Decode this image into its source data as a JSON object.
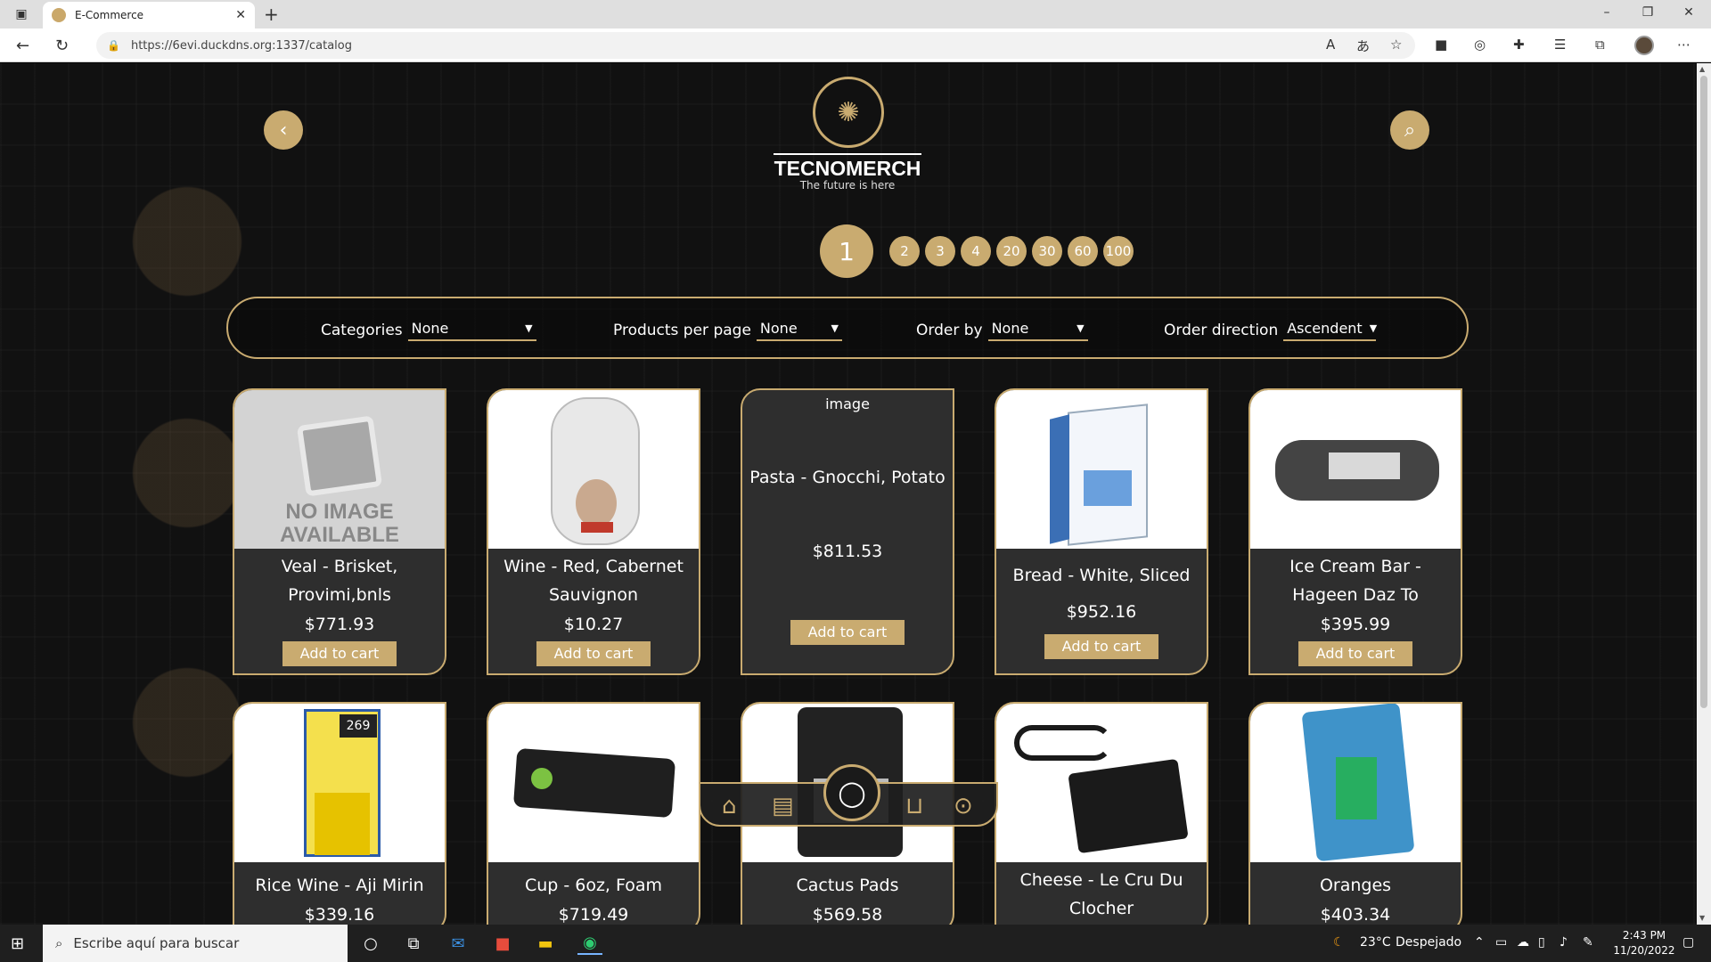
{
  "browser": {
    "tab_title": "E-Commerce",
    "url": "https://6evi.duckdns.org:1337/catalog"
  },
  "site": {
    "brand": "TECNOMERCH",
    "tagline": "The future is here"
  },
  "pagination": {
    "current": "1",
    "pages": [
      "2",
      "3",
      "4",
      "20",
      "30",
      "60",
      "100"
    ]
  },
  "filters": {
    "categories_label": "Categories",
    "categories_value": "None",
    "per_page_label": "Products per page",
    "per_page_value": "None",
    "order_by_label": "Order by",
    "order_by_value": "None",
    "order_dir_label": "Order direction",
    "order_dir_value": "Ascendent"
  },
  "cart_button_label": "Add to cart",
  "products_row1": [
    {
      "name": "Veal - Brisket, Provimi,bnls",
      "price": "$771.93",
      "image": "no-image-placeholder",
      "no_image_text": "NO IMAGE AVAILABLE"
    },
    {
      "name": "Wine - Red, Cabernet Sauvignon",
      "price": "$10.27",
      "image": "earphones-package"
    },
    {
      "name": "Pasta - Gnocchi, Potato",
      "price": "$811.53",
      "image": "broken-image",
      "alt": "image"
    },
    {
      "name": "Bread - White, Sliced",
      "price": "$952.16",
      "image": "software-box"
    },
    {
      "name": "Ice Cream Bar - Hageen Daz To",
      "price": "$395.99",
      "image": "mp3-player"
    }
  ],
  "products_row2": [
    {
      "name": "Rice Wine - Aji Mirin",
      "price": "$339.16",
      "image": "ink-cartridge"
    },
    {
      "name": "Cup - 6oz, Foam",
      "price": "$719.49",
      "image": "mini-pc-stick"
    },
    {
      "name": "Cactus Pads",
      "price": "$569.58",
      "image": "camera-battery"
    },
    {
      "name": "Cheese - Le Cru Du Clocher",
      "price": "",
      "image": "power-adapter"
    },
    {
      "name": "Oranges",
      "price": "$403.34",
      "image": "usb-cable-package"
    }
  ],
  "taskbar": {
    "search_placeholder": "Escribe aquí para buscar",
    "weather_temp": "23°C",
    "weather_text": "Despejado",
    "time": "2:43 PM",
    "date": "11/20/2022"
  },
  "colors": {
    "accent": "#c9ab70",
    "background": "#111111",
    "card": "#2e2e2e"
  }
}
